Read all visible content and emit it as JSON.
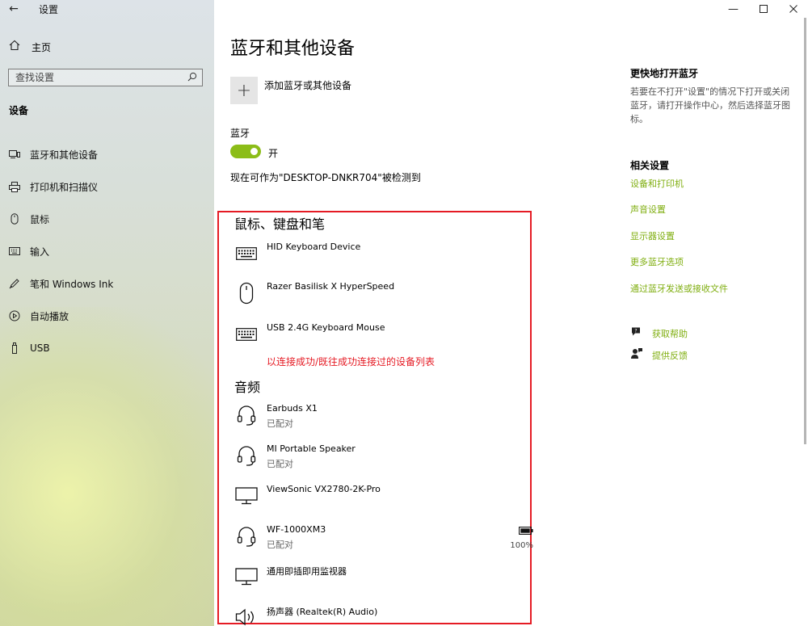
{
  "window": {
    "title": "设置"
  },
  "sidebar": {
    "home": "主页",
    "search_placeholder": "查找设置",
    "section": "设备",
    "items": [
      {
        "label": "蓝牙和其他设备",
        "icon": "bluetooth-devices-icon"
      },
      {
        "label": "打印机和扫描仪",
        "icon": "printer-icon"
      },
      {
        "label": "鼠标",
        "icon": "mouse-icon"
      },
      {
        "label": "输入",
        "icon": "keyboard-icon"
      },
      {
        "label": "笔和 Windows Ink",
        "icon": "pen-icon"
      },
      {
        "label": "自动播放",
        "icon": "autoplay-icon"
      },
      {
        "label": "USB",
        "icon": "usb-icon"
      }
    ]
  },
  "main": {
    "title": "蓝牙和其他设备",
    "add_device_label": "添加蓝牙或其他设备",
    "bluetooth_label": "蓝牙",
    "toggle_state": "开",
    "discoverable_text": "现在可作为\"DESKTOP-DNKR704\"被检测到",
    "group_input_title": "鼠标、键盘和笔",
    "input_devices": [
      {
        "name": "HID Keyboard Device",
        "icon": "keyboard-icon"
      },
      {
        "name": "Razer Basilisk X HyperSpeed",
        "icon": "mouse-icon"
      },
      {
        "name": "USB 2.4G Keyboard Mouse",
        "icon": "keyboard-icon"
      }
    ],
    "annotation": "以连接成功/既往成功连接过的设备列表",
    "group_audio_title": "音频",
    "audio_devices": [
      {
        "name": "Earbuds X1",
        "status": "已配对",
        "icon": "headset-icon"
      },
      {
        "name": "MI Portable Speaker",
        "status": "已配对",
        "icon": "headset-icon"
      },
      {
        "name": "ViewSonic VX2780-2K-Pro",
        "status": "",
        "icon": "monitor-icon"
      },
      {
        "name": "WF-1000XM3",
        "status": "已配对",
        "icon": "headset-icon",
        "battery": "100%"
      },
      {
        "name": "通用即插即用监视器",
        "status": "",
        "icon": "monitor-icon"
      },
      {
        "name": "扬声器 (Realtek(R) Audio)",
        "status": "",
        "icon": "speaker-icon"
      }
    ]
  },
  "side": {
    "quick_title": "更快地打开蓝牙",
    "quick_desc": "若要在不打开\"设置\"的情况下打开或关闭蓝牙，请打开操作中心，然后选择蓝牙图标。",
    "related_title": "相关设置",
    "links": [
      "设备和打印机",
      "声音设置",
      "显示器设置",
      "更多蓝牙选项",
      "通过蓝牙发送或接收文件"
    ],
    "help": "获取帮助",
    "feedback": "提供反馈"
  },
  "colors": {
    "accent": "#8cbd18",
    "link": "#7fae0f",
    "annotation": "#e51b24"
  }
}
